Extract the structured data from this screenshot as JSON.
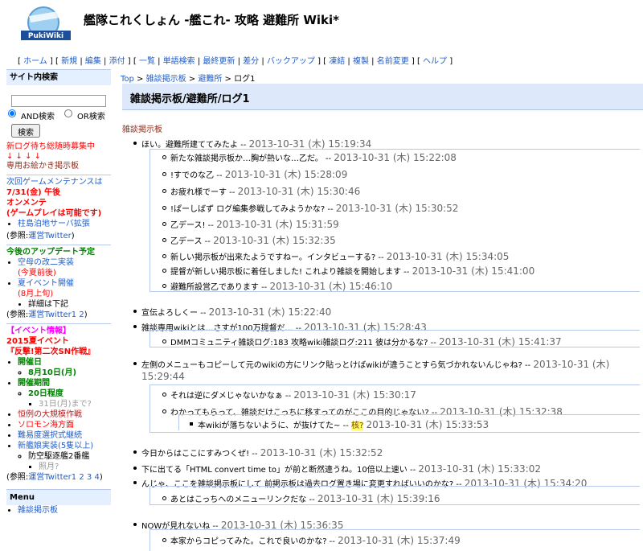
{
  "header": {
    "logo_text": "PukiWiki",
    "title": "艦隊これくしょん -艦これ- 攻略 避難所 Wiki*"
  },
  "topnav": [
    "ホーム",
    "新規",
    "編集",
    "添付",
    "一覧",
    "単語検索",
    "最終更新",
    "差分",
    "バックアップ",
    "凍結",
    "複製",
    "名前変更",
    "ヘルプ"
  ],
  "sidebar": {
    "search_title": "サイト内検索",
    "and_label": "AND検索",
    "or_label": "OR検索",
    "search_button": "検索",
    "recruit_1": "新ログ待ち総随時募集中",
    "arrows": "↓ ↓ ↓ ↓",
    "recruit_2": "専用お絵かき掲示板",
    "maint_1": "次回ゲームメンテナンスは",
    "maint_2": "7/31(金) 午後",
    "maint_3": "オンメンテ",
    "maint_4": "(ゲームプレイは可能です)",
    "maint_item": "柱島泊地サーバ拡張",
    "ref_prefix": "(参照:",
    "ref_official": "運営Twitter",
    "ref_suffix": ")",
    "update_title": "今後のアップデート予定",
    "upd_1": "空母の改二実装",
    "upd_1_sub": "(今夏前後)",
    "upd_2": "夏イベント開催",
    "upd_2_sub": "(8月上旬)",
    "upd_2_detail": "詳細は下記",
    "ref2_link": "運営Twitter",
    "ref2_nums": [
      "1",
      "2"
    ],
    "event_title_1": "【イベント情報】",
    "event_title_2": "2015夏イベント",
    "event_title_3": "『反撃!第二次SN作戦』",
    "ev_start_label": "開催日",
    "ev_start": "8月10日(月)",
    "ev_period_label": "開催期間",
    "ev_period": "20日程度",
    "ev_period_sub": "31日(月)まで?",
    "ev_item_1": "恒例の大規模作戦",
    "ev_item_2": "ソロモン海方面",
    "ev_item_3": "難易度選択式継続",
    "ev_item_4": "新艦娘実装(5隻以上)",
    "ev_item_4_sub": "防空駆逐艦2番艦",
    "ev_item_4_sub2": "照月?",
    "ref3_link": "運営Twitter",
    "ref3_nums": [
      "1",
      "2",
      "3",
      "4"
    ],
    "menu_title": "Menu",
    "menu_first": "雑談掲示板"
  },
  "breadcrumb": {
    "top": "Top",
    "board": "雑談掲示板",
    "refuge": "避難所",
    "current": "ログ1"
  },
  "page_title": "雑談掲示板/避難所/ログ1",
  "board_link": "雑談掲示板",
  "comments": {
    "c1": "ほい。避難所建ててみたよ --",
    "t1": "2013-10-31 (木) 15:19:34",
    "c1a": "新たな雑談掲示板か…胸が熱いな…乙だ。 --",
    "t1a": "2013-10-31 (木) 15:22:08",
    "c1b": "!すでのな乙 --",
    "t1b": "2013-10-31 (木) 15:28:09",
    "c1c": "お疲れ様でーす --",
    "t1c": "2013-10-31 (木) 15:30:46",
    "c1d": "!ぱーしばず ログ編集参戦してみようかな? --",
    "t1d": "2013-10-31 (木) 15:30:52",
    "c1e": "乙デース! --",
    "t1e": "2013-10-31 (木) 15:31:59",
    "c1f": "乙デース --",
    "t1f": "2013-10-31 (木) 15:32:35",
    "c1g": "新しい掲示板が出来たようですねー。インタビューする? --",
    "t1g": "2013-10-31 (木) 15:34:05",
    "c1h": "提督が新しい掲示板に着任しました! これより雑談を開始します --",
    "t1h": "2013-10-31 (木) 15:41:00",
    "c1i": "避難所設営乙であります --",
    "t1i": "2013-10-31 (木) 15:46:10",
    "c2": "宣伝よろしくー --",
    "t2": "2013-10-31 (木) 15:22:40",
    "c3": "雑談専用wikiとは…さすが100万提督だ… --",
    "t3": "2013-10-31 (木) 15:28:43",
    "c3a": "DMMコミュニティ雑談ログ:183 攻略wiki雑談ログ:211 彼は分かるな? --",
    "t3a": "2013-10-31 (木) 15:41:37",
    "c4": "左側のメニューもコピーして元のwikiの方にリンク貼っとけばwikiが違うことすら気づかれないんじゃね? --",
    "t4": "2013-10-31 (木)",
    "t4b": "15:29:44",
    "c4a": "それは逆にダメじゃないかなぁ --",
    "t4a": "2013-10-31 (木) 15:30:17",
    "c4b": "わかってもらって、雑談だけこっちに移すってのがここの目的じゃない? --",
    "t4bb": "2013-10-31 (木) 15:32:38",
    "c4c": "本wikiが落ちないように、が抜けてた~ --",
    "c4c_link": "核?",
    "t4c": "2013-10-31 (木) 15:33:53",
    "c5": "今日からはここにすみつくぜ! --",
    "t5": "2013-10-31 (木) 15:32:52",
    "c6": "下に出てる「HTML convert time to」が前と断然違うね。10倍以上速い --",
    "t6": "2013-10-31 (木) 15:33:02",
    "c7": "んじゃ、ここを雑談掲示板にして 前掲示板は過去ログ置き場に変更すればいいのかな? --",
    "t7": "2013-10-31 (木) 15:34:20",
    "c7a": "あとはこっちへのメニューリンクだな --",
    "t7a": "2013-10-31 (木) 15:39:16",
    "c8": "NOWが見れないね --",
    "t8": "2013-10-31 (木) 15:36:35",
    "c8a": "本家からコピってみた。これで良いのかな? --",
    "t8a": "2013-10-31 (木) 15:37:49"
  }
}
